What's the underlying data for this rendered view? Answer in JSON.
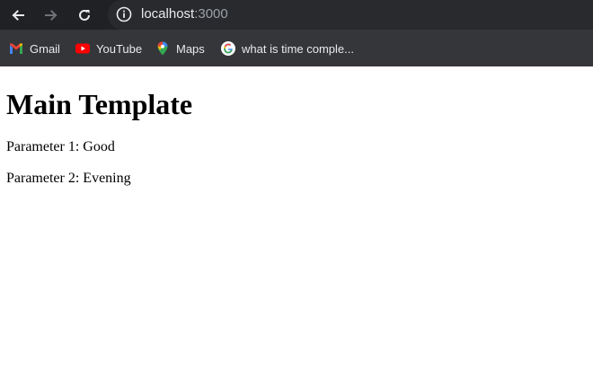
{
  "browser": {
    "url_host": "localhost",
    "url_port": ":3000",
    "bookmarks": [
      {
        "label": "Gmail",
        "icon": "gmail-icon"
      },
      {
        "label": "YouTube",
        "icon": "youtube-icon"
      },
      {
        "label": "Maps",
        "icon": "maps-icon"
      },
      {
        "label": "what is time comple...",
        "icon": "google-icon"
      }
    ]
  },
  "page": {
    "title": "Main Template",
    "param1": "Parameter 1: Good",
    "param2": "Parameter 2: Evening"
  },
  "colors": {
    "toolbar_bg": "#202124",
    "bookmarks_bg": "#35363a",
    "page_bg": "#ffffff"
  }
}
